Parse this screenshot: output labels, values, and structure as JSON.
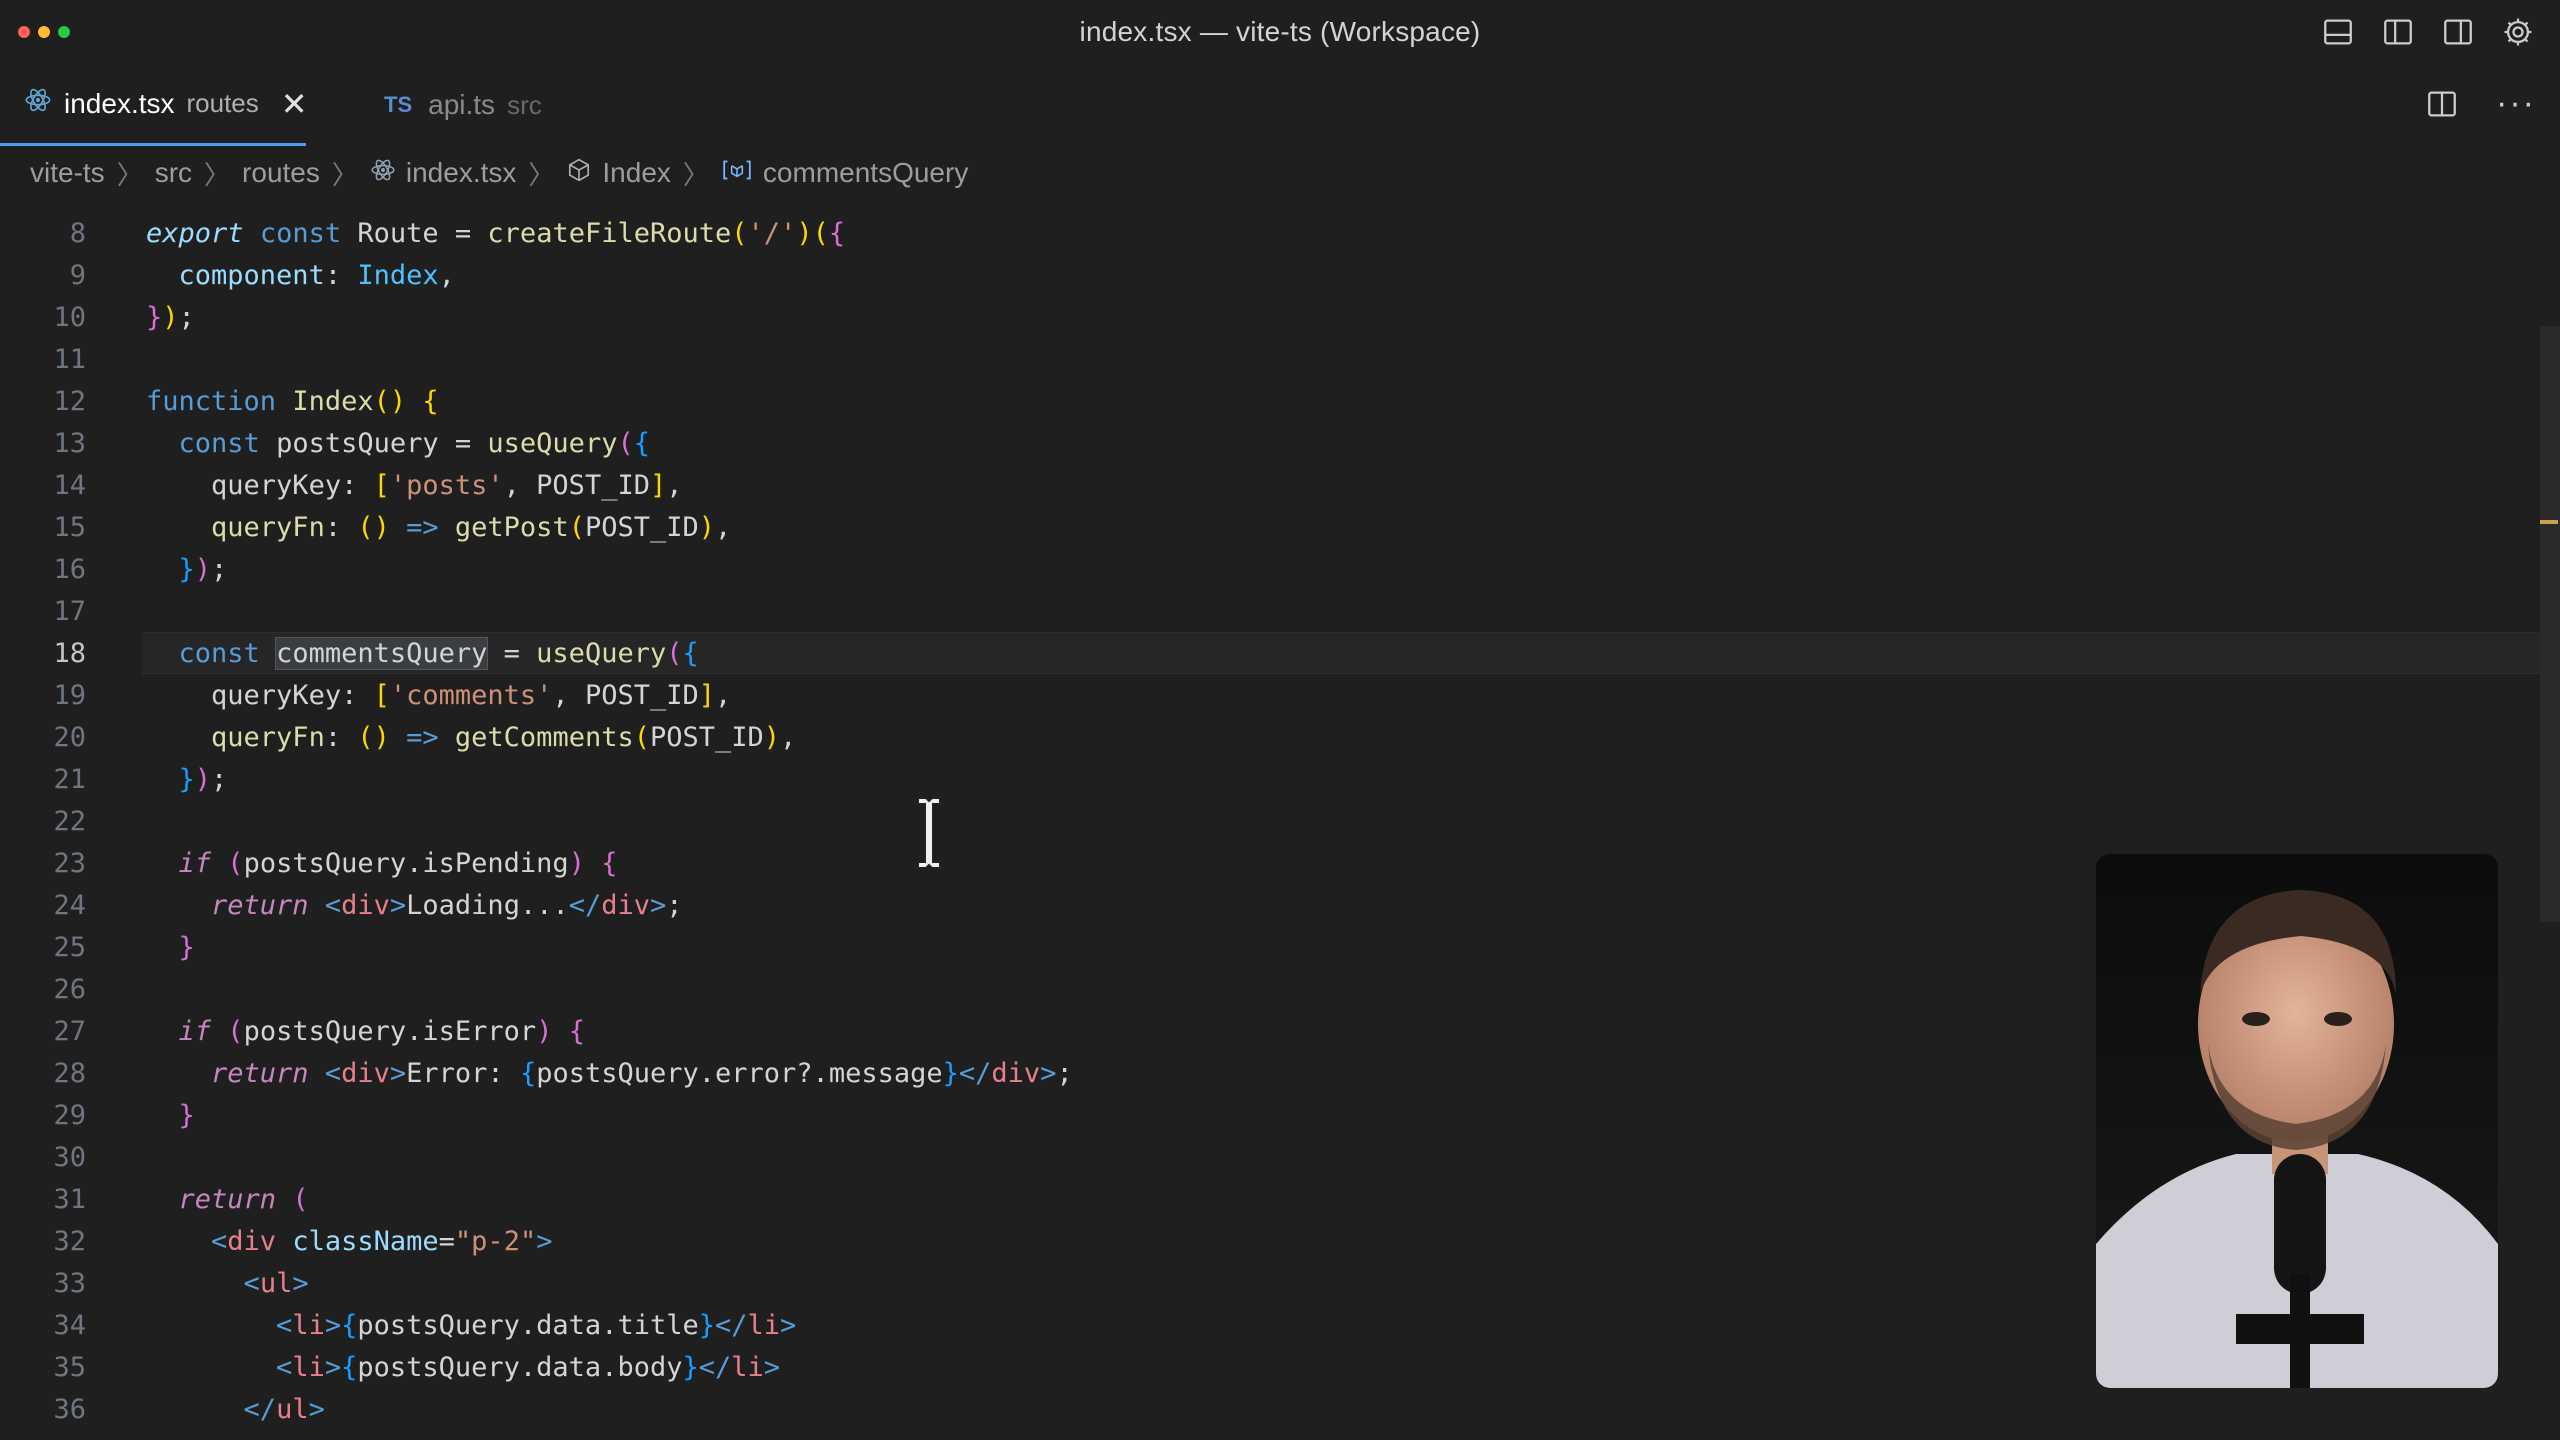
{
  "window": {
    "title": "index.tsx — vite-ts (Workspace)"
  },
  "tabs": [
    {
      "label": "index.tsx",
      "desc": "routes",
      "active": true,
      "icon": "react-icon"
    },
    {
      "label": "api.ts",
      "desc": "src",
      "active": false,
      "badge": "TS"
    }
  ],
  "breadcrumb": {
    "items": [
      "vite-ts",
      "src",
      "routes",
      "index.tsx",
      "Index",
      "commentsQuery"
    ]
  },
  "editor": {
    "active_line": 18,
    "highlighted_symbol": "commentsQuery",
    "lines": [
      {
        "n": "8"
      },
      {
        "n": "9"
      },
      {
        "n": "10"
      },
      {
        "n": "11"
      },
      {
        "n": "12"
      },
      {
        "n": "13"
      },
      {
        "n": "14"
      },
      {
        "n": "15"
      },
      {
        "n": "16"
      },
      {
        "n": "17"
      },
      {
        "n": "18"
      },
      {
        "n": "19"
      },
      {
        "n": "20"
      },
      {
        "n": "21"
      },
      {
        "n": "22"
      },
      {
        "n": "23"
      },
      {
        "n": "24"
      },
      {
        "n": "25"
      },
      {
        "n": "26"
      },
      {
        "n": "27"
      },
      {
        "n": "28"
      },
      {
        "n": "29"
      },
      {
        "n": "30"
      },
      {
        "n": "31"
      },
      {
        "n": "32"
      },
      {
        "n": "33"
      },
      {
        "n": "34"
      },
      {
        "n": "35"
      },
      {
        "n": "36"
      }
    ],
    "code": {
      "export": "export",
      "const": "const",
      "Route": "Route",
      "createFileRoute": "createFileRoute",
      "slash": "'/'",
      "component": "component",
      "Index": "Index",
      "function": "function",
      "postsQuery": "postsQuery",
      "useQuery": "useQuery",
      "queryKey": "queryKey",
      "posts_str": "'posts'",
      "POST_ID": "POST_ID",
      "queryFn": "queryFn",
      "getPost": "getPost",
      "commentsQuery": "commentsQuery",
      "comments_str": "'comments'",
      "getComments": "getComments",
      "if": "if",
      "isPending": "isPending",
      "return": "return",
      "div": "div",
      "Loading": "Loading...",
      "isError": "isError",
      "Error": "Error: ",
      "error_message": "postsQuery.error?.message",
      "className": "className",
      "p2": "\"p-2\"",
      "ul": "ul",
      "li": "li",
      "data_title": "postsQuery.data.title",
      "data_body": "postsQuery.data.body"
    }
  },
  "colors": {
    "accent": "#4d9cf7",
    "background": "#1f1f1f"
  }
}
